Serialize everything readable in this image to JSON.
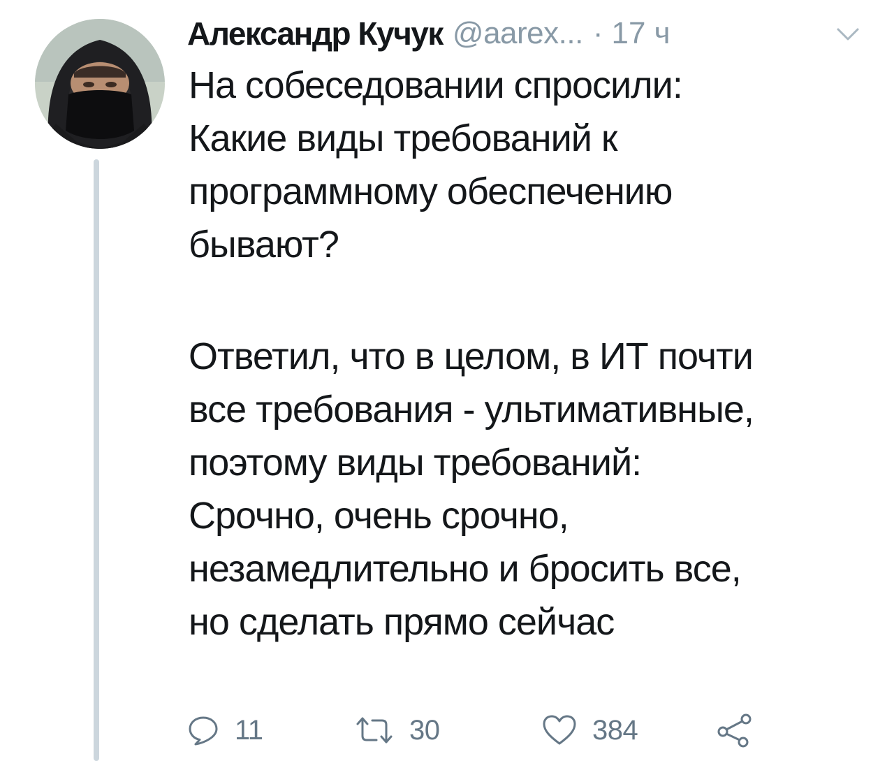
{
  "tweet": {
    "author": {
      "display_name": "Александр Кучук",
      "handle": "@aarex...",
      "avatar_icon": "masked-person-avatar"
    },
    "separator": "·",
    "time": "17 ч",
    "menu_icon": "chevron-down-icon",
    "text_lines_1": [
      "На собеседовании спросили:",
      "Какие виды требований к",
      "программному обеспечению",
      "бывают?"
    ],
    "text_lines_2": [
      "Ответил, что в целом, в ИТ почти",
      "все требования - ультимативные,",
      "поэтому виды требований:",
      "Срочно, очень срочно,",
      "незамедлительно и бросить все,",
      "но сделать прямо сейчас"
    ],
    "actions": {
      "reply": {
        "icon": "reply-icon",
        "count": "11"
      },
      "retweet": {
        "icon": "retweet-icon",
        "count": "30"
      },
      "like": {
        "icon": "heart-icon",
        "count": "384"
      },
      "share": {
        "icon": "share-icon"
      }
    },
    "colors": {
      "text": "#14171a",
      "secondary": "#8899a6",
      "icon": "#657786",
      "thread_line": "#ccd6dd"
    }
  }
}
